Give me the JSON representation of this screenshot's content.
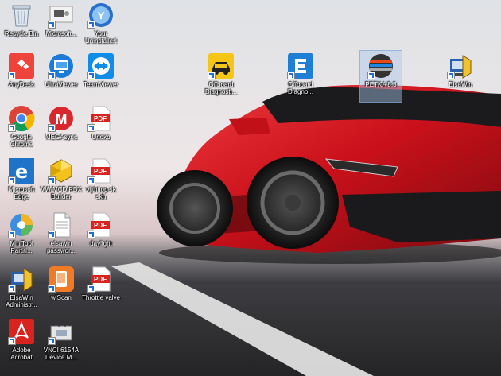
{
  "desktop": {
    "icons": [
      {
        "label": "Recycle Bin",
        "icon": "recycle-bin-icon"
      },
      {
        "label": "Microsoft...",
        "icon": "microsoft-app-icon"
      },
      {
        "label": "Your Uninstaller!",
        "icon": "uninstaller-icon"
      },
      {
        "label": "AnyDesk",
        "icon": "anydesk-icon"
      },
      {
        "label": "UltraViewer",
        "icon": "ultraviewer-icon"
      },
      {
        "label": "TeamViewer",
        "icon": "teamviewer-icon"
      },
      {
        "label": "Offboard Diagnosti...",
        "icon": "offboard-diagnostic-icon"
      },
      {
        "label": "Offboard Diagno...",
        "icon": "offboard-diagnostic-blue-icon"
      },
      {
        "label": "PETKA 8.3",
        "icon": "petka-icon"
      },
      {
        "label": "ElsaWin",
        "icon": "elsawin-icon"
      },
      {
        "label": "Google Chrome",
        "icon": "chrome-icon"
      },
      {
        "label": "MEGAsync",
        "icon": "megasync-icon"
      },
      {
        "label": "Unoko",
        "icon": "pdf-icon"
      },
      {
        "label": "Microsoft Edge",
        "icon": "edge-icon"
      },
      {
        "label": "VW MCD PDX Builder",
        "icon": "pdx-builder-icon"
      },
      {
        "label": "vijthtiop sk skh",
        "icon": "pdf-icon"
      },
      {
        "label": "MiniTool Partiti...",
        "icon": "minitool-icon"
      },
      {
        "label": "elsawin passwor...",
        "icon": "text-file-icon"
      },
      {
        "label": "daylight",
        "icon": "pdf-icon"
      },
      {
        "label": "ElsaWin Administr...",
        "icon": "elsawin-admin-icon"
      },
      {
        "label": "wiScan",
        "icon": "wiscan-icon"
      },
      {
        "label": "Throttle valve",
        "icon": "pdf-icon"
      },
      {
        "label": "Adobe Acrobat",
        "icon": "adobe-acrobat-icon"
      },
      {
        "label": "VNCI 6154A Device M...",
        "icon": "vnci-device-icon"
      }
    ]
  },
  "colors": {
    "pdf_red": "#d8231f",
    "anydesk_red": "#ef443b",
    "chrome_red": "#db4437",
    "car_red": "#d0141d",
    "selection": "#aac8eb"
  }
}
